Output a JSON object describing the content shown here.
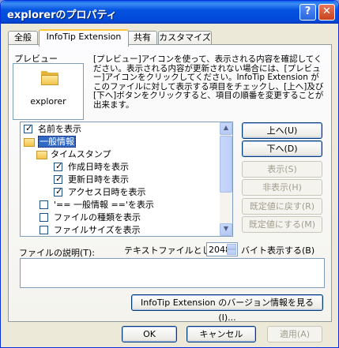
{
  "window": {
    "title": "explorerのプロパティ",
    "help_button": "?",
    "close_button": "✕"
  },
  "tabs": [
    {
      "label": "全般"
    },
    {
      "label": "InfoTip Extension"
    },
    {
      "label": "共有"
    },
    {
      "label": "カスタマイズ"
    }
  ],
  "preview": {
    "heading": "プレビュー",
    "name": "explorer",
    "icon": "folder-icon"
  },
  "description": "[プレビュー]アイコンを使って、表示される内容を確認してください。表示される内容が更新されない場合には、[プレビュー]アイコンをクリックしてください。InfoTip Extension がこのファイルに対して表示する項目をチェックし、[上へ]及び[下へ]ボタンをクリックすると、項目の順番を変更することが出来ます。",
  "tree": {
    "items": [
      {
        "label": "名前を表示",
        "checked": true,
        "type": "checkbox"
      },
      {
        "label": "一般情報",
        "type": "folder",
        "selected": true
      },
      {
        "label": "タイムスタンプ",
        "type": "folder"
      },
      {
        "label": "作成日時を表示",
        "checked": true,
        "type": "checkbox"
      },
      {
        "label": "更新日時を表示",
        "checked": true,
        "type": "checkbox"
      },
      {
        "label": "アクセス日時を表示",
        "checked": true,
        "type": "checkbox"
      },
      {
        "label": "'== 一般情報 =='を表示",
        "checked": false,
        "type": "checkbox"
      },
      {
        "label": "ファイルの種類を表示",
        "checked": false,
        "type": "checkbox"
      },
      {
        "label": "ファイルサイズを表示",
        "checked": false,
        "type": "checkbox"
      }
    ]
  },
  "side_buttons": {
    "up": "上へ(U)",
    "down": "下へ(D)",
    "show": "表示(S)",
    "hide": "非表示(H)",
    "reset": "既定値に戻す(R)",
    "set_default": "既定値にする(M)"
  },
  "file_desc": {
    "label": "ファイルの説明(T):",
    "text_file_label": "テキストファイルとして",
    "bytes_value": "2048",
    "bytes_suffix": "バイト表示する(B)",
    "value": ""
  },
  "version_button": "InfoTip Extension のバージョン情報を見る(I)...",
  "footer": {
    "ok": "OK",
    "cancel": "キャンセル",
    "apply": "適用(A)"
  },
  "colors": {
    "titlebar": "#0453e0",
    "selection": "#316ac5",
    "dialog_bg": "#ece9d8"
  }
}
